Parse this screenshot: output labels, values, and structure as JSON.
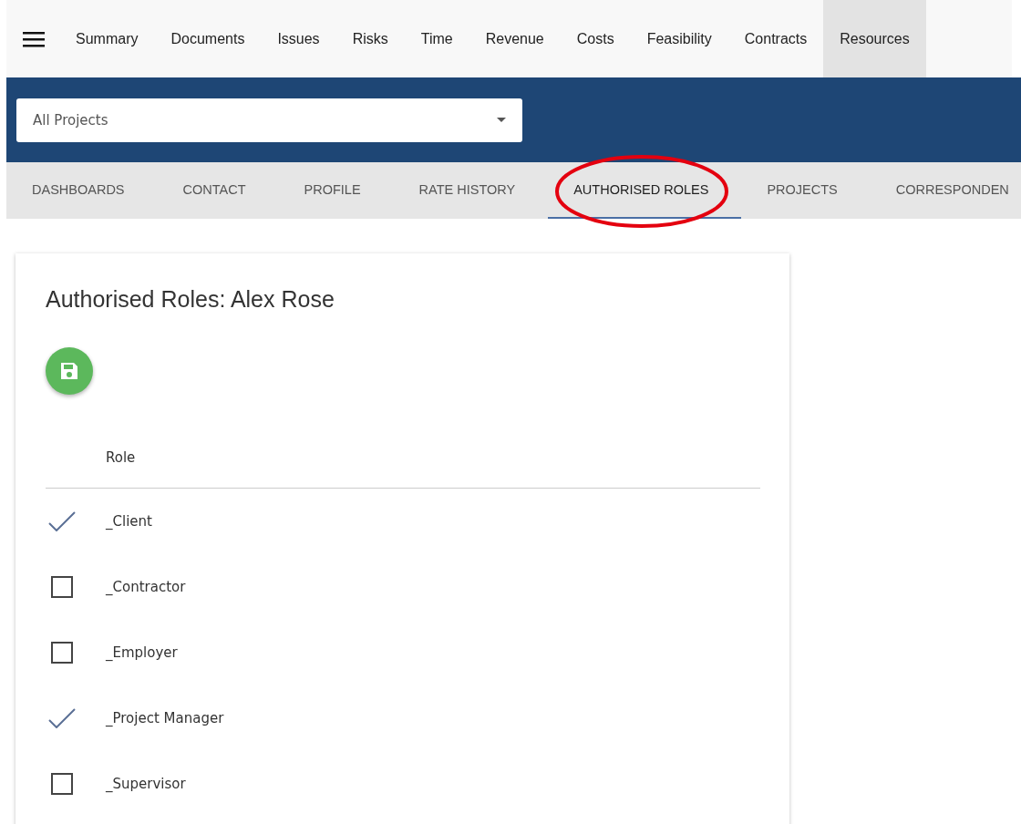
{
  "nav": {
    "items": [
      {
        "label": "Summary",
        "selected": false
      },
      {
        "label": "Documents",
        "selected": false
      },
      {
        "label": "Issues",
        "selected": false
      },
      {
        "label": "Risks",
        "selected": false
      },
      {
        "label": "Time",
        "selected": false
      },
      {
        "label": "Revenue",
        "selected": false
      },
      {
        "label": "Costs",
        "selected": false
      },
      {
        "label": "Feasibility",
        "selected": false
      },
      {
        "label": "Contracts",
        "selected": false
      },
      {
        "label": "Resources",
        "selected": true
      }
    ]
  },
  "project_select": {
    "value": "All Projects"
  },
  "tabs": [
    {
      "label": "DASHBOARDS",
      "selected": false
    },
    {
      "label": "CONTACT",
      "selected": false
    },
    {
      "label": "PROFILE",
      "selected": false
    },
    {
      "label": "RATE HISTORY",
      "selected": false
    },
    {
      "label": "AUTHORISED ROLES",
      "selected": true
    },
    {
      "label": "PROJECTS",
      "selected": false
    },
    {
      "label": "CORRESPONDEN",
      "selected": false
    }
  ],
  "card": {
    "title": "Authorised Roles: Alex Rose",
    "table": {
      "columns": [
        "Role"
      ],
      "rows": [
        {
          "role": "_Client",
          "checked": true
        },
        {
          "role": "_Contractor",
          "checked": false
        },
        {
          "role": "_Employer",
          "checked": false
        },
        {
          "role": "_Project Manager",
          "checked": true
        },
        {
          "role": "_Supervisor",
          "checked": false
        }
      ]
    }
  }
}
